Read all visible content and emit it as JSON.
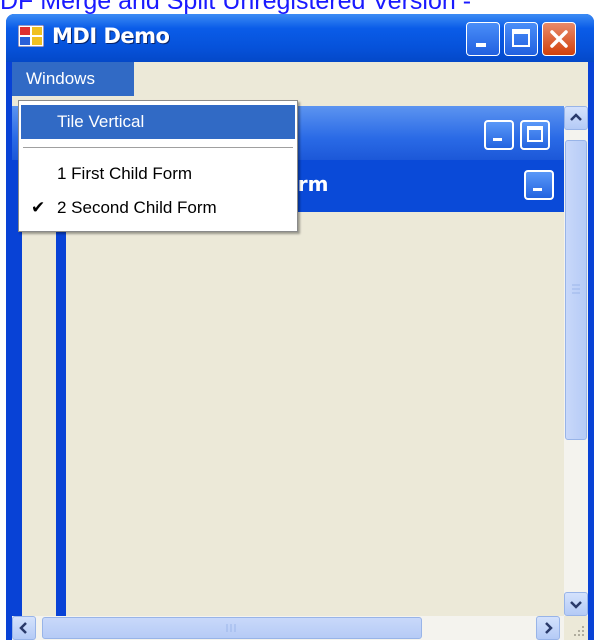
{
  "watermark": "DF Merge and Split Unregistered Version -",
  "window": {
    "title": "MDI Demo"
  },
  "menu": {
    "windows_label": "Windows"
  },
  "dropdown": {
    "items": [
      {
        "label": "Tile Vertical",
        "highlighted": true
      },
      {
        "label": "1 First Child Form",
        "checked": false
      },
      {
        "label": "2 Second Child Form",
        "checked": true
      }
    ],
    "check_glyph": "✔"
  },
  "child_forms": {
    "second_title_visible": "orm"
  },
  "scrollbar": {
    "up_glyph": "⌃",
    "down_glyph": "⌄",
    "left_glyph": "❮",
    "right_glyph": "❯"
  },
  "colors": {
    "xp_blue": "#0842d6",
    "menu_highlight": "#316ac5",
    "client_bg": "#ece9d8",
    "watermark": "#1a1aff"
  }
}
